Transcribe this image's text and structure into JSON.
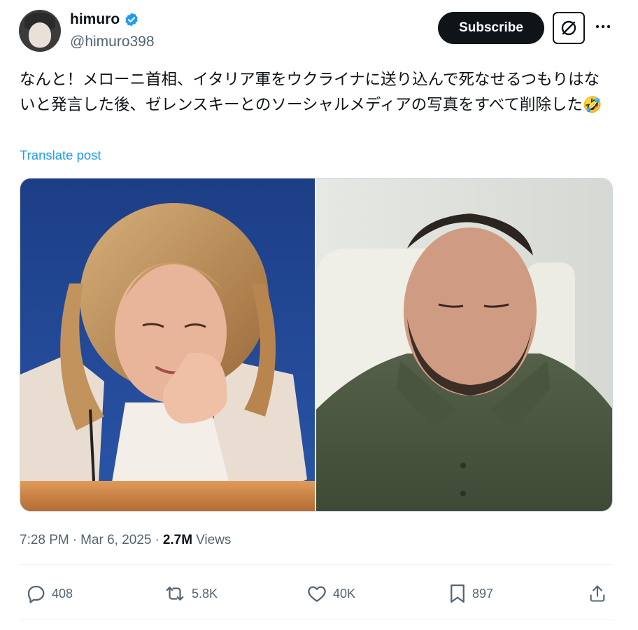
{
  "author": {
    "display_name": "himuro",
    "handle": "@himuro398",
    "avatar_icon": "avatar",
    "verified_color": "#1d9bf0"
  },
  "header": {
    "subscribe_label": "Subscribe",
    "grok_icon": "grok-icon",
    "more_icon": "more-icon"
  },
  "post": {
    "text": "なんと！メローニ首相、イタリア軍をウクライナに送り込んで死なせるつもりはないと発言した後、ゼレンスキーとのソーシャルメディアの写真をすべて削除した🤣",
    "translate_label": "Translate post"
  },
  "media": {
    "images": [
      {
        "name": "photo-left"
      },
      {
        "name": "photo-right"
      }
    ]
  },
  "meta": {
    "time": "7:28 PM",
    "separator": "·",
    "date": "Mar 6, 2025",
    "views_count": "2.7M",
    "views_label": "Views"
  },
  "actions": {
    "replies": "408",
    "reposts": "5.8K",
    "likes": "40K",
    "bookmarks": "897"
  },
  "colors": {
    "accent": "#1d9bf0",
    "text": "#0f1419",
    "secondary": "#536471"
  }
}
